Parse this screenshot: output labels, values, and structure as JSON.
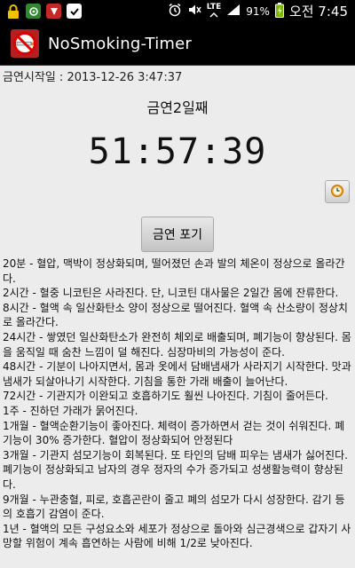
{
  "status_bar": {
    "network": "LTE",
    "battery": "91%",
    "clock": "오전 7:45",
    "icons": [
      "lock-icon",
      "shield-icon",
      "notification-icon",
      "check-icon",
      "alarm-icon",
      "mute-icon",
      "wifi-icon",
      "signal-icon",
      "battery-icon"
    ]
  },
  "app": {
    "title": "NoSmoking-Timer",
    "icon": "no-smoking-icon"
  },
  "main": {
    "start_line": "금연시작일 : 2013-12-26 3:47:37",
    "day_label": "금연2일째",
    "timer": "51:57:39",
    "giveup_label": "금연 포기",
    "clock_icon": "clock-icon"
  },
  "milestones": [
    "20분 - 혈압, 맥박이 정상화되며, 떨어졌던 손과 발의 체온이 정상으로 올라간다.",
    "2시간 - 혈중 니코틴은 사라진다. 단, 니코틴 대사물은 2일간 몸에 잔류한다.",
    "8시간 - 혈액 속 일산화탄소 양이 정상으로 떨어진다. 혈액 속 산소량이 정상치로 올라간다.",
    "24시간 - 쌓였던 일산화탄소가 완전히 체외로 배출되며, 폐기능이 향상된다. 몸을 움직일 때 숨찬 느낌이 덜 해진다. 심장마비의 가능성이 준다.",
    "48시간 - 기분이 나아지면서, 몸과 옷에서 담배냄새가 사라지기 시작한다. 맛과 냄새가 되살아나기 시작한다. 기침을 통한 가래 배출이 늘어난다.",
    "72시간 - 기관지가 이완되고 호흡하기도 훨씬 나아진다. 기침이 줄어든다.",
    "1주 - 진하던 가래가 묽어진다.",
    "1개월 - 혈액순환기능이 좋아진다. 체력이 증가하면서 걷는 것이 쉬워진다. 폐기능이 30% 증가한다. 혈압이 정상화되어 안정된다",
    "3개월 - 기관지 섬모기능이 회복된다. 또 타인의 담배 피우는 냄새가 싫어진다. 폐기능이 정상화되고 남자의 경우 정자의 수가 증가되고 성생활능력이 향상된다.",
    "9개월 - 누관충혈, 피로, 호흡곤란이 줄고 폐의 섬모가 다시 성장한다. 감기 등의 호흡기 감염이 준다.",
    "1년 - 혈액의 모든 구성요소와 세포가 정상으로 돌아와 심근경색으로 갑자기 사망할 위험이 계속 흡연하는 사람에 비해 1/2로 낮아진다."
  ]
}
